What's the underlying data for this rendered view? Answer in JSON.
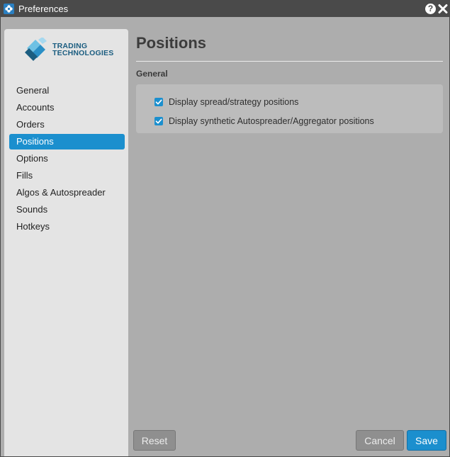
{
  "window": {
    "title": "Preferences",
    "app_icon": "tt-flower-icon",
    "help_icon": "question-icon",
    "help_glyph": "?",
    "close_icon": "close-icon"
  },
  "logo": {
    "line1": "TRADING",
    "line2": "TECHNOLOGIES",
    "icon": "tt-diamond-logo"
  },
  "sidebar": {
    "items": [
      {
        "label": "General",
        "active": false
      },
      {
        "label": "Accounts",
        "active": false
      },
      {
        "label": "Orders",
        "active": false
      },
      {
        "label": "Positions",
        "active": true
      },
      {
        "label": "Options",
        "active": false
      },
      {
        "label": "Fills",
        "active": false
      },
      {
        "label": "Algos & Autospreader",
        "active": false
      },
      {
        "label": "Sounds",
        "active": false
      },
      {
        "label": "Hotkeys",
        "active": false
      }
    ]
  },
  "main": {
    "title": "Positions",
    "section": "General",
    "options": [
      {
        "label": "Display spread/strategy positions",
        "checked": true
      },
      {
        "label": "Display synthetic Autospreader/Aggregator positions",
        "checked": true
      }
    ]
  },
  "footer": {
    "reset_label": "Reset",
    "cancel_label": "Cancel",
    "save_label": "Save"
  },
  "colors": {
    "accent": "#1b8fce",
    "titlebar": "#4a4a4a",
    "background": "#adadad",
    "sidebar": "#e4e4e4"
  }
}
